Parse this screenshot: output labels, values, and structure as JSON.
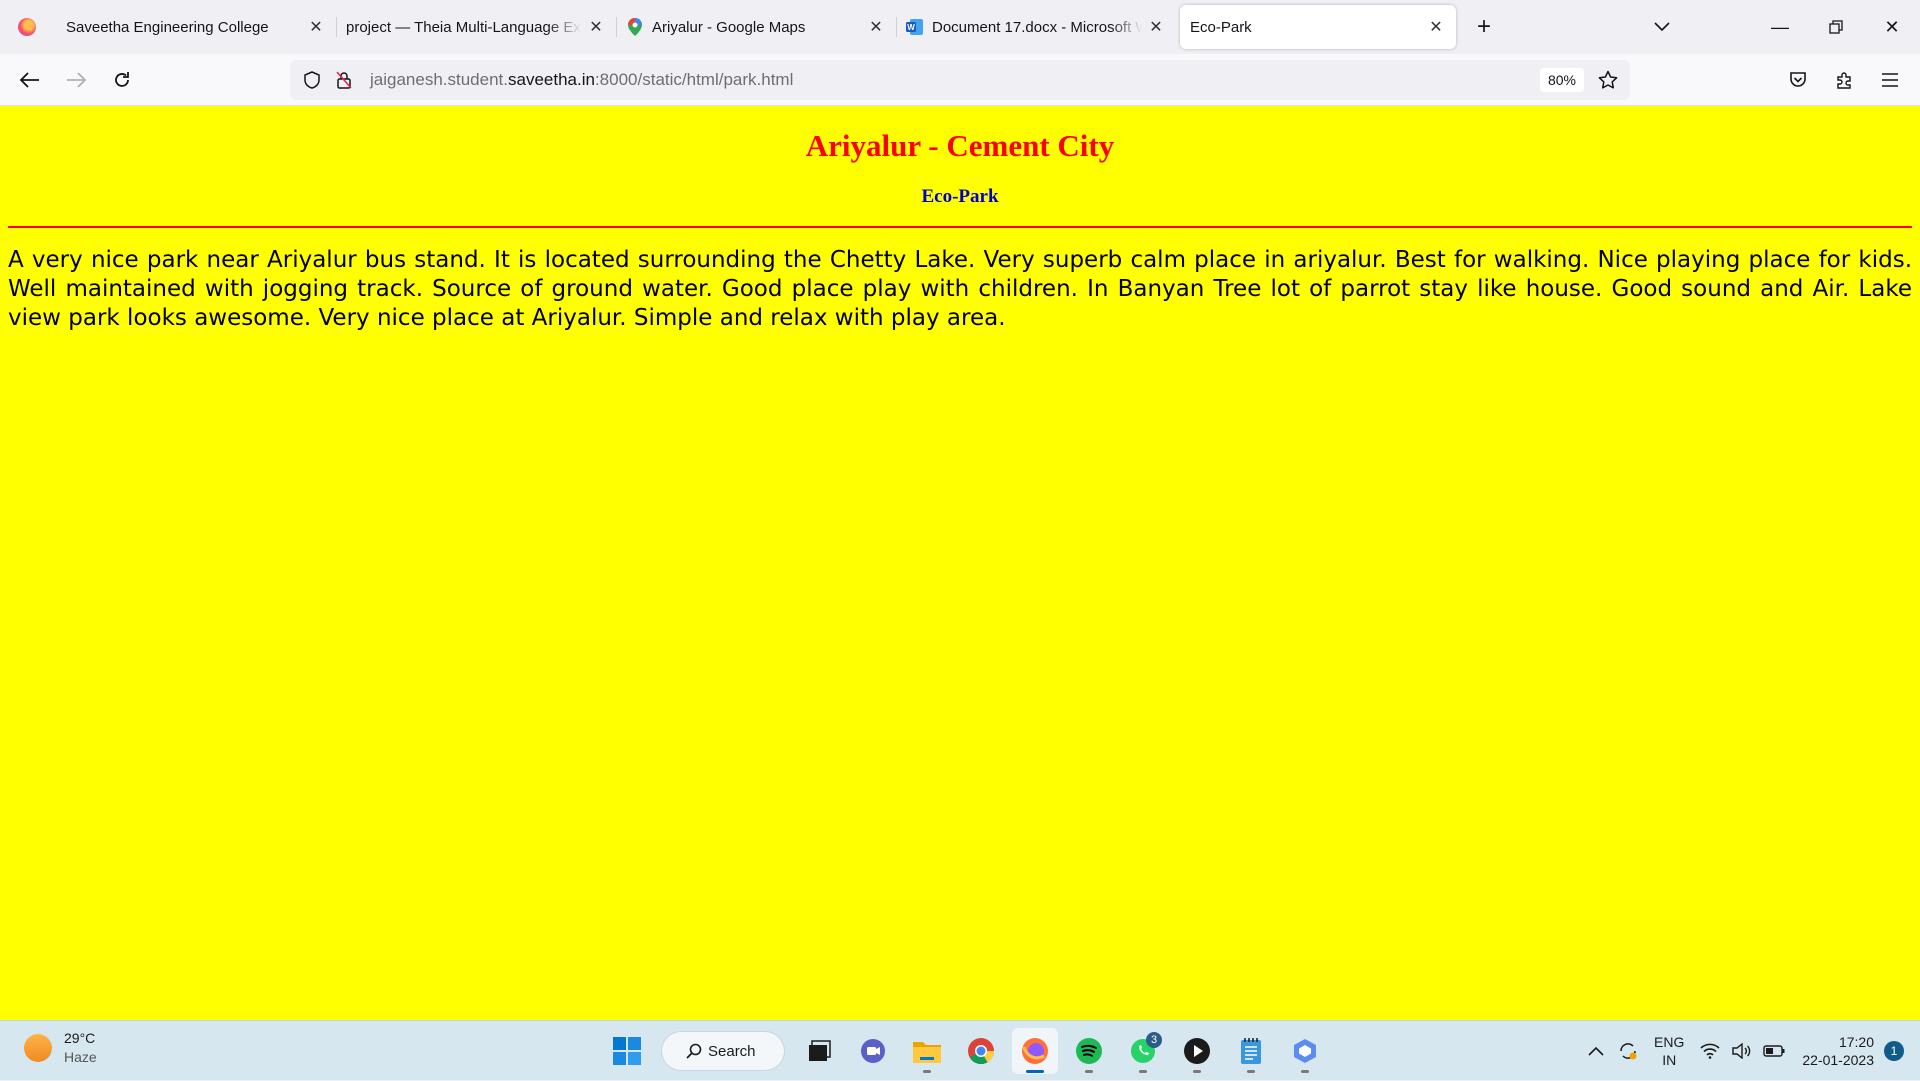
{
  "browser": {
    "tabs": [
      {
        "title": "Saveetha Engineering College",
        "favicon": "none-icon",
        "active": false
      },
      {
        "title": "project — Theia Multi-Language Ex",
        "favicon": "none-icon",
        "active": false
      },
      {
        "title": "Ariyalur - Google Maps",
        "favicon": "google-maps-icon",
        "active": false
      },
      {
        "title": "Document 17.docx - Microsoft W",
        "favicon": "word-icon",
        "active": false
      },
      {
        "title": "Eco-Park",
        "favicon": "none-icon",
        "active": true
      }
    ],
    "url": {
      "prefix": "jaiganesh.student.",
      "domain": "saveetha.in",
      "suffix": ":8000/static/html/park.html"
    },
    "zoom": "80%"
  },
  "page": {
    "heading": "Ariyalur - Cement City",
    "subheading": "Eco-Park",
    "paragraph": "A very nice park near Ariyalur bus stand. It is located surrounding the Chetty Lake. Very superb calm place in ariyalur. Best for walking. Nice playing place for kids. Well maintained with jogging track. Source of ground water. Good place play with children. In Banyan Tree lot of parrot stay like house. Good sound and Air. Lake view park looks awesome. Very nice place at Ariyalur. Simple and relax with play area.",
    "colors": {
      "background": "#ffff00",
      "heading": "#ff0000",
      "subheading": "#0000cc",
      "rule": "#ff0000"
    }
  },
  "taskbar": {
    "weather": {
      "temp": "29°C",
      "condition": "Haze"
    },
    "search_label": "Search",
    "whatsapp_badge": "3",
    "lang_top": "ENG",
    "lang_bottom": "IN",
    "time": "17:20",
    "date": "22-01-2023",
    "notification_count": "1"
  }
}
